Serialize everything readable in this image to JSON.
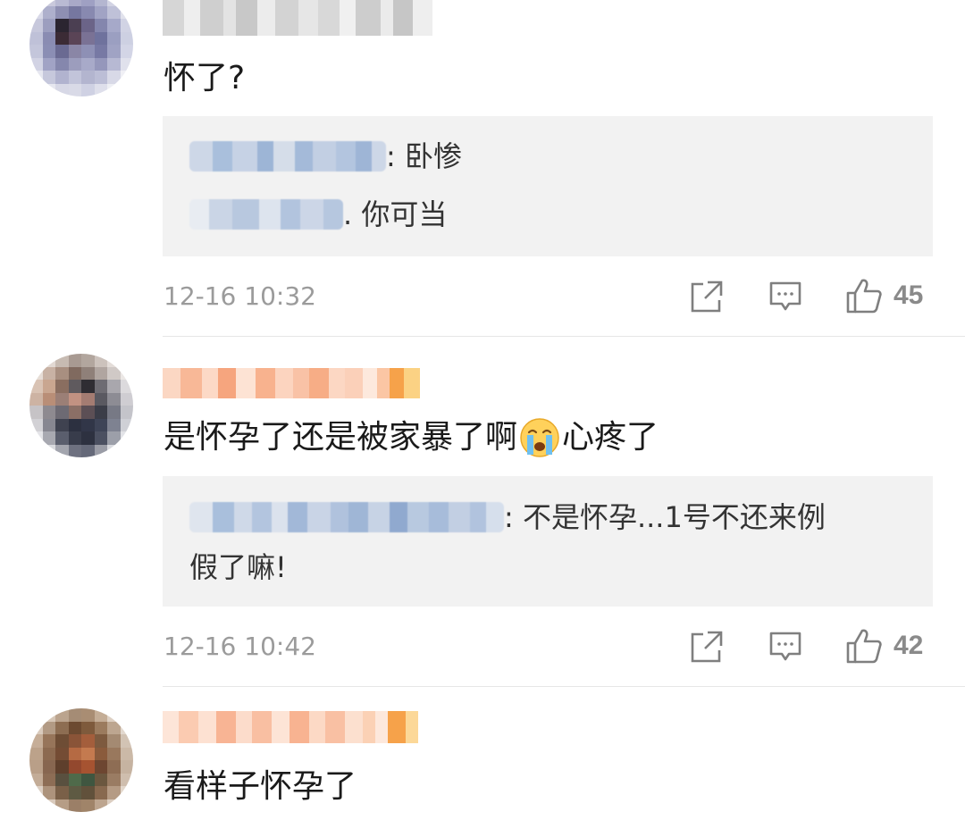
{
  "comments": [
    {
      "text": "怀了?",
      "replies": [
        {
          "text": ": 卧惨"
        },
        {
          "text": ". 你可当"
        }
      ],
      "time": "12-16 10:32",
      "likes": "45"
    },
    {
      "text_before_emoji": "是怀孕了还是被家暴了啊",
      "emoji": "crying-face",
      "text_after_emoji": "心疼了",
      "replies": [
        {
          "text": ": 不是怀孕...1号不还来例"
        },
        {
          "text": "假了嘛!"
        }
      ],
      "time": "12-16 10:42",
      "likes": "42"
    },
    {
      "text": "看样子怀孕了"
    }
  ],
  "icons": {
    "repost": "share-square-icon",
    "reply": "comment-bubble-icon",
    "like": "thumbs-up-icon"
  },
  "colors": {
    "reply_bg": "#f2f2f2",
    "meta_text": "#9b9b9b",
    "vip_name_orange": "#f7a76b",
    "normal_name_blue": "#a9bfdc"
  }
}
